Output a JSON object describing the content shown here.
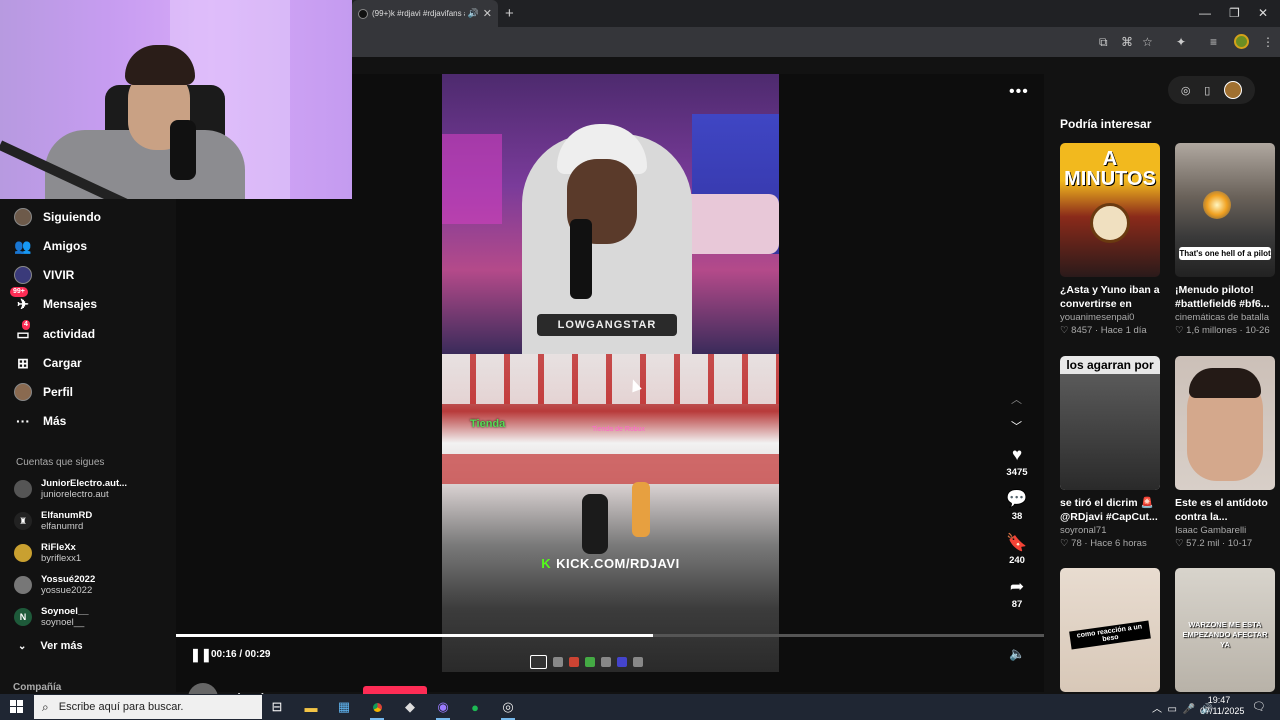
{
  "browser": {
    "tab_title": "(99+)k #rdjavi #rdjavifans #",
    "tab_close": "✕",
    "new_tab": "+",
    "window_controls": {
      "minimize": "—",
      "restore": "❐",
      "close": "✕"
    }
  },
  "sidebar": {
    "items": [
      {
        "label": "Siguiendo",
        "icon": "avatar",
        "badge": ""
      },
      {
        "label": "Amigos",
        "icon": "friends-icon",
        "badge": ""
      },
      {
        "label": "VIVIR",
        "icon": "live-icon",
        "badge": ""
      },
      {
        "label": "Mensajes",
        "icon": "messages-icon",
        "badge": "99+"
      },
      {
        "label": "actividad",
        "icon": "activity-icon",
        "badge": "4"
      },
      {
        "label": "Cargar",
        "icon": "upload-icon",
        "badge": ""
      },
      {
        "label": "Perfil",
        "icon": "profile-icon",
        "badge": ""
      },
      {
        "label": "Más",
        "icon": "more-icon",
        "badge": ""
      }
    ],
    "following_title": "Cuentas que sigues",
    "accounts": [
      {
        "name": "JuniorElectro.aut...",
        "handle": "juniorelectro.aut"
      },
      {
        "name": "ElfanumRD",
        "handle": "elfanumrd"
      },
      {
        "name": "RiFleXx",
        "handle": "byriflexx1"
      },
      {
        "name": "Yossué2022",
        "handle": "yossue2022"
      },
      {
        "name": "Soynoel__",
        "handle": "soynoel__"
      }
    ],
    "see_more": "Ver más",
    "company": "Compañía"
  },
  "video": {
    "overlay_logo": "LOWGANGSTAR",
    "game_tag": "Tienda",
    "game_tag2": "Tienda de Robux",
    "kick_text": "KICK.COM/RDJAVI",
    "kick_letter": "K",
    "time_current": "00:16",
    "time_total": "00:29",
    "time_display": "00:16 / 00:29",
    "progress": 0.55,
    "likes": "3475",
    "comments": "38",
    "saves": "240",
    "shares": "87",
    "author": "crissshzz"
  },
  "recommendations": {
    "heading": "Podría interesar",
    "cards": [
      {
        "overlay": "A MINUTOS",
        "title": "¿Asta y Yuno iban a convertirse en Rey...",
        "author": "youanimesenpai0",
        "likes": "8457",
        "when": "Hace 1 día"
      },
      {
        "overlay": "That's one hell of a pilot",
        "title": "¡Menudo piloto! #battlefield6 #bf6...",
        "author": "cinemáticas de batalla",
        "likes": "1,6 millones",
        "when": "10-26"
      },
      {
        "overlay": "los agarran por",
        "title": "se tiró el dicrim 🚨 @RDjavi #CapCut...",
        "author": "soyronal71",
        "likes": "78",
        "when": "Hace 6 horas"
      },
      {
        "overlay": "",
        "title": "Este es el antídoto contra la...",
        "author": "Isaac Gambarelli",
        "likes": "57.2 mil",
        "when": "10-17"
      },
      {
        "overlay": "como reacción a un beso",
        "title": "",
        "author": "",
        "likes": "",
        "when": ""
      },
      {
        "overlay": "WARZONE ME ESTA EMPEZANDO AFECTAR YA",
        "title": "",
        "author": "",
        "likes": "",
        "when": ""
      }
    ]
  },
  "taskbar": {
    "search_placeholder": "Escribe aquí para buscar.",
    "time": "19:47",
    "date": "07/11/2025"
  }
}
